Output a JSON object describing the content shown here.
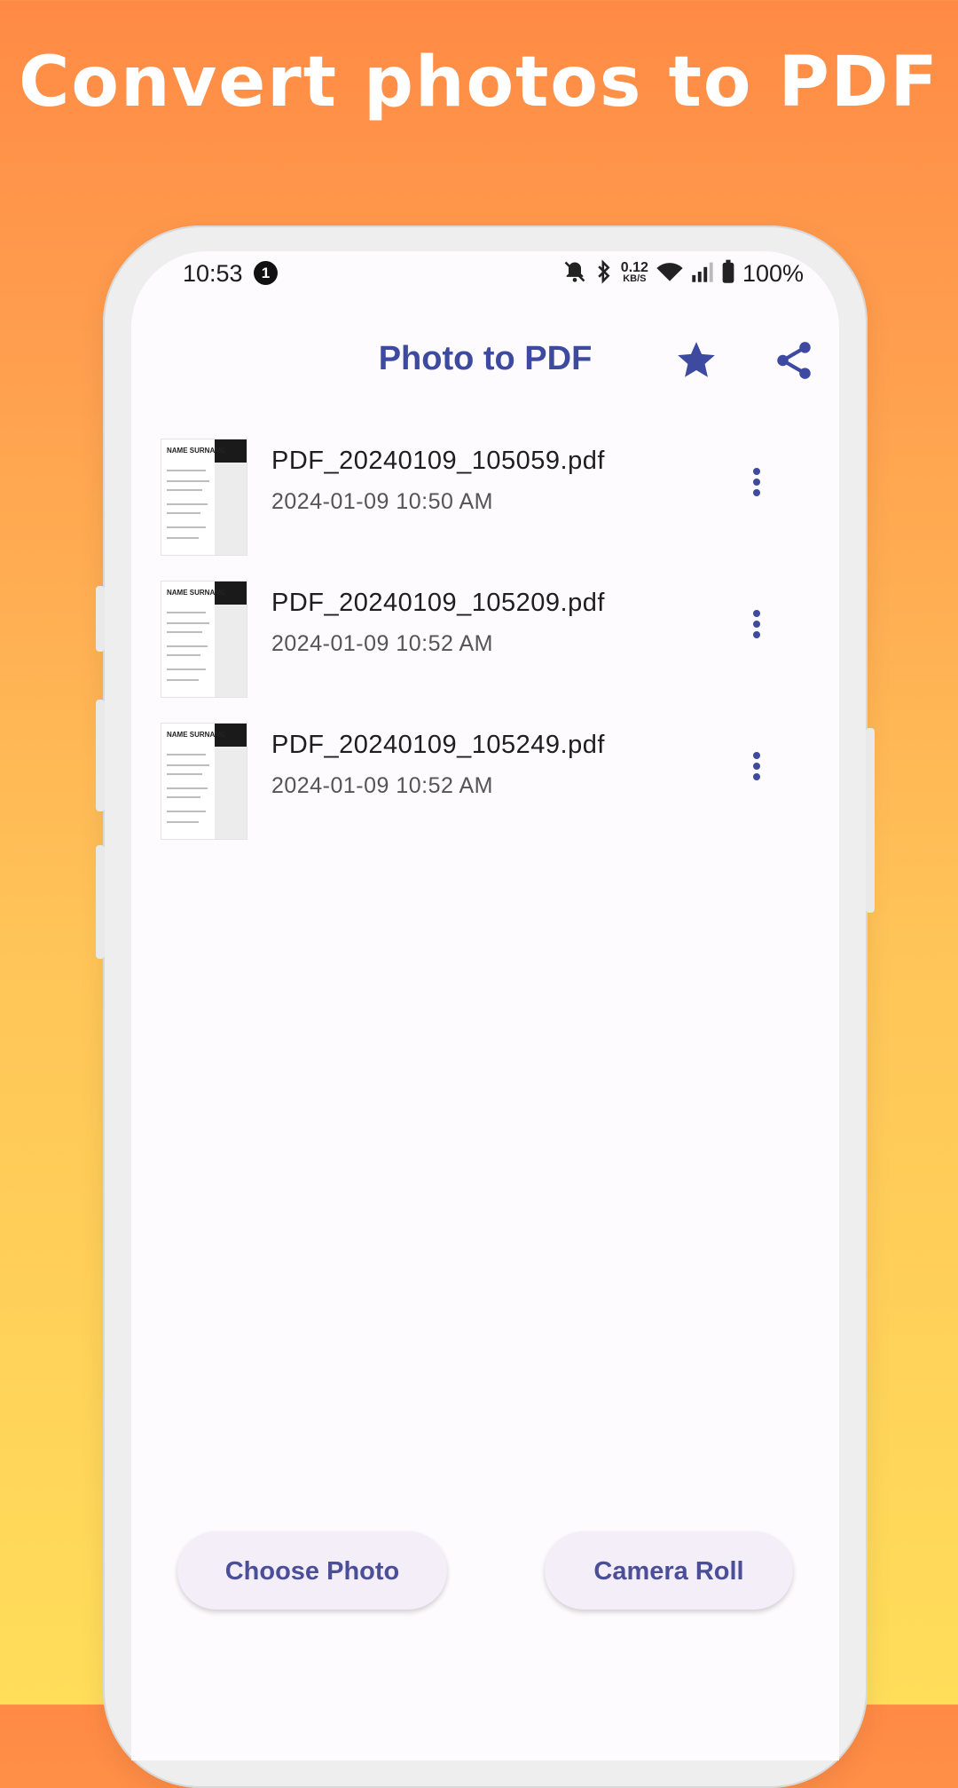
{
  "headline": "Convert photos to PDF",
  "status_bar": {
    "time": "10:53",
    "notification_count": "1",
    "speed_value": "0.12",
    "speed_unit": "KB/S",
    "battery": "100%"
  },
  "app_bar": {
    "title": "Photo to PDF",
    "icons": [
      "star-icon",
      "share-icon"
    ]
  },
  "files": [
    {
      "name": "PDF_20240109_105059.pdf",
      "date": "2024-01-09 10:50 AM"
    },
    {
      "name": "PDF_20240109_105209.pdf",
      "date": "2024-01-09 10:52 AM"
    },
    {
      "name": "PDF_20240109_105249.pdf",
      "date": "2024-01-09 10:52 AM"
    }
  ],
  "thumbnail_text": "NAME SURNAME",
  "actions": {
    "choose_photo": "Choose Photo",
    "camera_roll": "Camera Roll"
  },
  "colors": {
    "accent": "#3d4aa0",
    "background_top": "#ff8a45",
    "background_bottom": "#ffde5a"
  }
}
